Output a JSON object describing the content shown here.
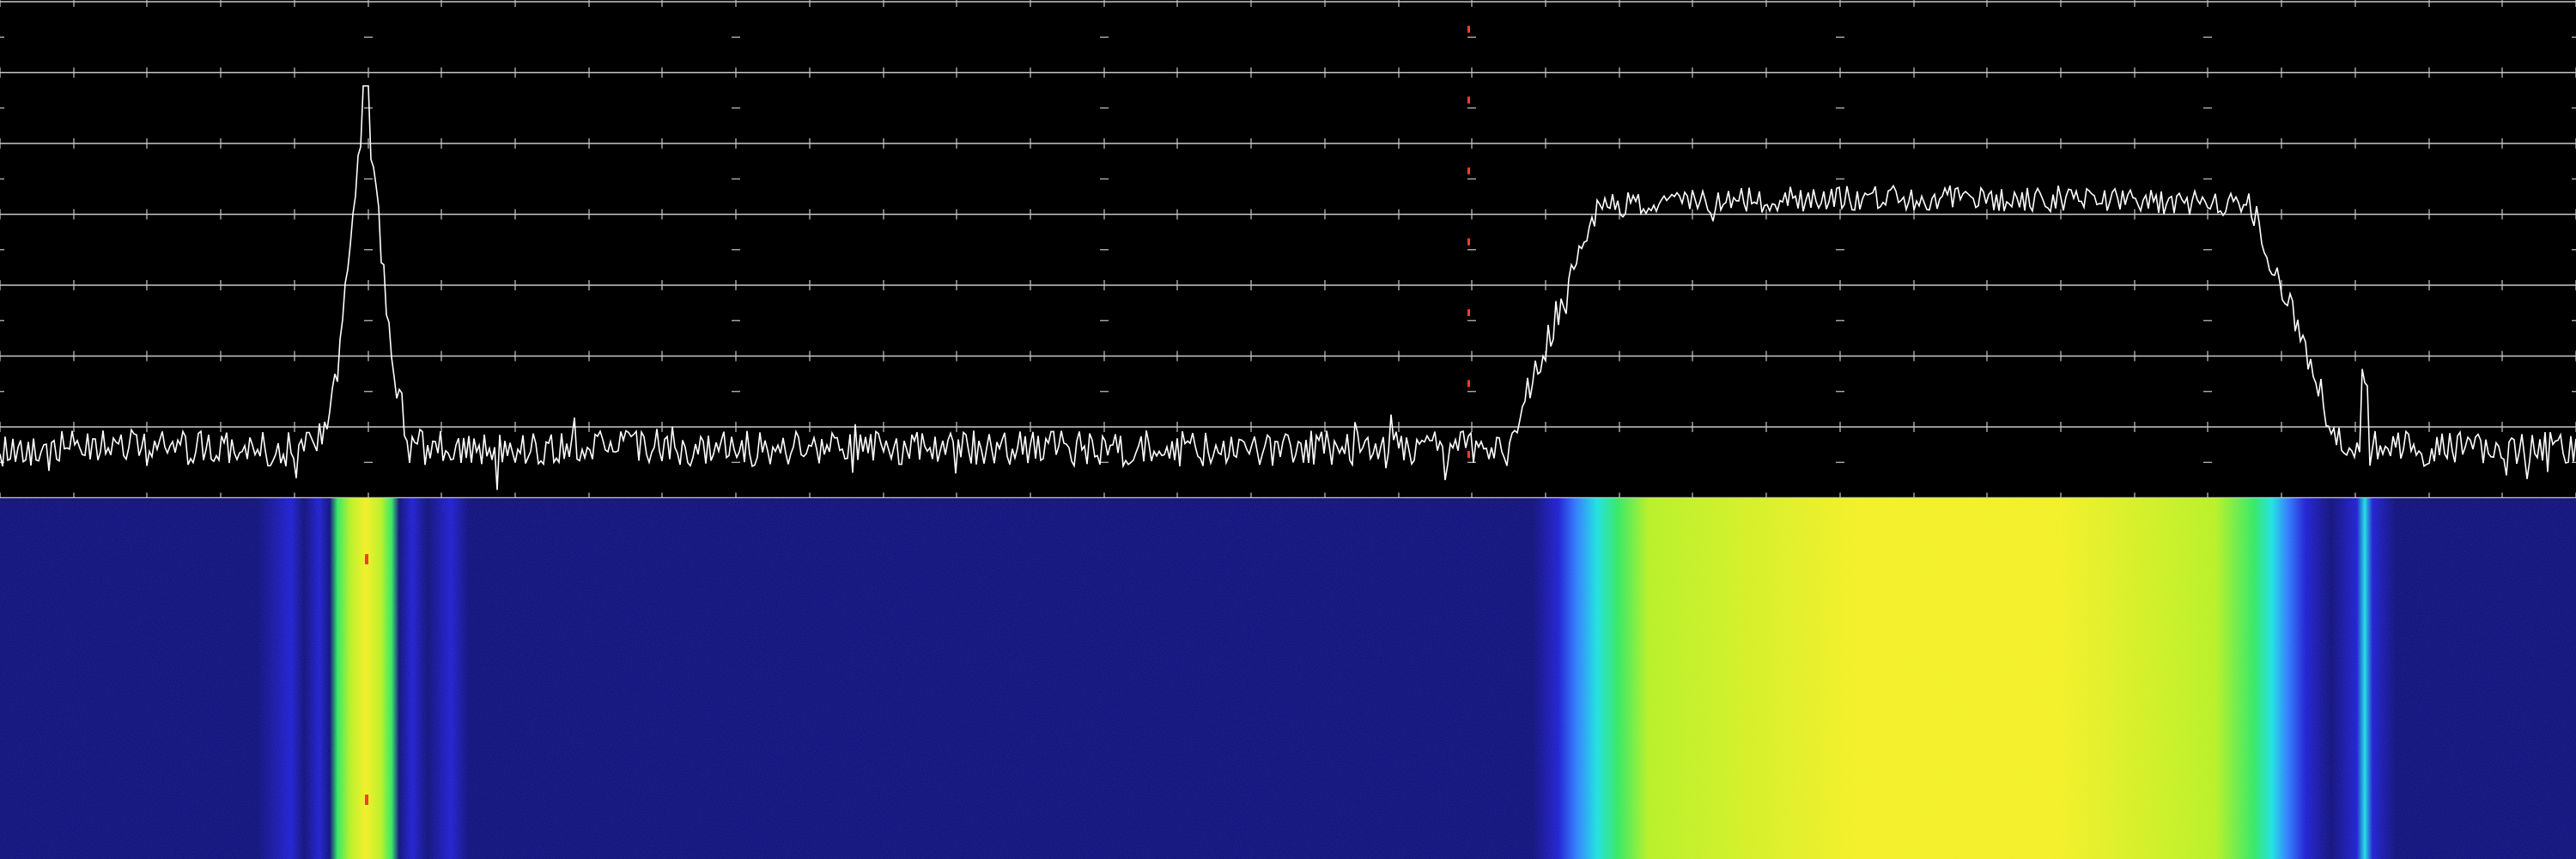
{
  "window": {
    "title": ""
  },
  "display": {
    "spectrum": {
      "trace_color": "#ffffff",
      "grid_color": "#c8c8c8",
      "center_marker_color": "#ff3b2a",
      "background": "#000000",
      "horizontal_gridlines": 7,
      "tick_columns": 35
    },
    "waterfall": {
      "colormap": [
        "#0b0b7a",
        "#1a1ad0",
        "#2a7bff",
        "#19e0e0",
        "#2ee860",
        "#b6f020",
        "#f2ef20"
      ],
      "background": "#0a0a78"
    },
    "signals": [
      {
        "name": "narrowband-carrier",
        "center_fraction": 0.142,
        "width_fraction": 0.011,
        "level": 0.78
      },
      {
        "name": "wideband-signal",
        "start_fraction": 0.607,
        "end_fraction": 0.887,
        "level": 0.62
      },
      {
        "name": "weak-spur",
        "center_fraction": 0.918,
        "width_fraction": 0.0008,
        "level": 0.12
      }
    ],
    "center_marker_fraction": 0.57
  }
}
